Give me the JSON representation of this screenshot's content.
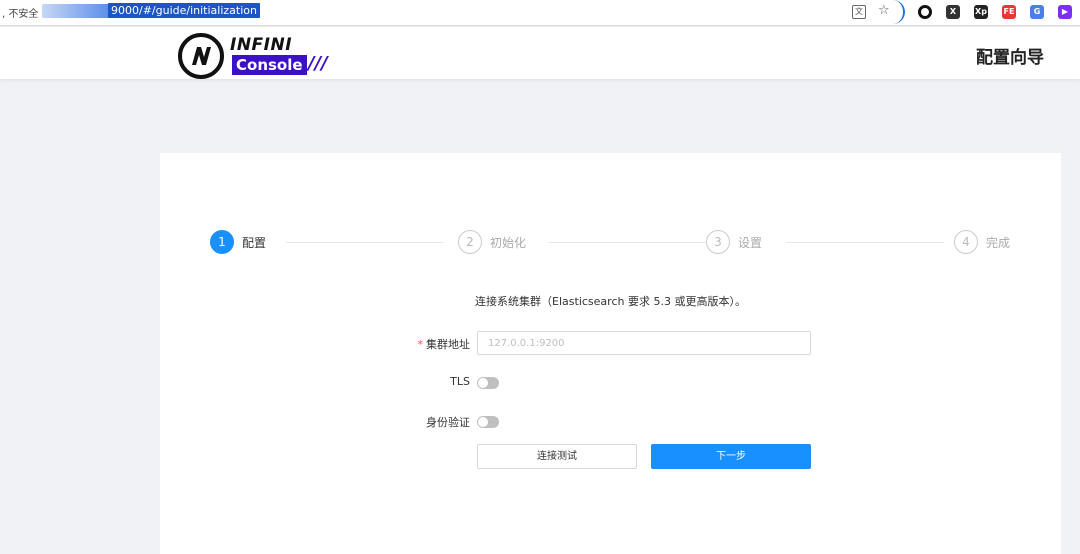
{
  "browser": {
    "security_label": ", 不安全",
    "url_path": "9000/#/guide/initialization",
    "translate_icon": "translate-icon",
    "bookmark_icon": "star-icon",
    "extensions": [
      {
        "name": "circle-extension-icon",
        "label": ""
      },
      {
        "name": "x-extension-icon",
        "label": "X"
      },
      {
        "name": "xp-extension-icon",
        "label": "Xp"
      },
      {
        "name": "fe-extension-icon",
        "label": "FE"
      },
      {
        "name": "translate-extension-icon",
        "label": "G"
      },
      {
        "name": "play-extension-icon",
        "label": "▶"
      }
    ]
  },
  "header": {
    "logo_top": "INFINI",
    "logo_bottom": "Console",
    "logo_slashes": "///",
    "title": "配置向导"
  },
  "steps": [
    {
      "num": "1",
      "label": "配置",
      "active": true
    },
    {
      "num": "2",
      "label": "初始化",
      "active": false
    },
    {
      "num": "3",
      "label": "设置",
      "active": false
    },
    {
      "num": "4",
      "label": "完成",
      "active": false
    }
  ],
  "form": {
    "intro": "连接系统集群（Elasticsearch 要求 5.3 或更高版本）。",
    "cluster_label": "集群地址",
    "cluster_required": "*",
    "cluster_placeholder": "127.0.0.1:9200",
    "cluster_value": "",
    "tls_label": "TLS",
    "tls_on": false,
    "auth_label": "身份验证",
    "auth_on": false,
    "test_button": "连接测试",
    "next_button": "下一步"
  },
  "colors": {
    "primary": "#1890ff",
    "brand": "#3b10c7",
    "required": "#ff4d4f"
  }
}
